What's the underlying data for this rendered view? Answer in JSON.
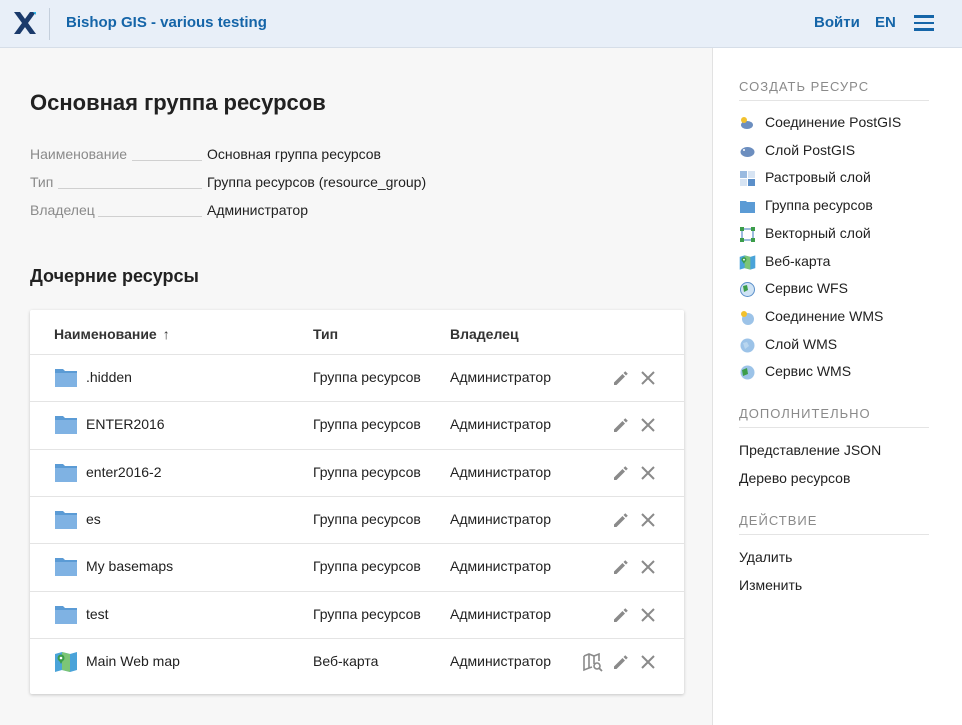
{
  "header": {
    "app_title": "Bishop GIS - various testing",
    "login_label": "Войти",
    "lang_label": "EN",
    "accent_color": "#1565a8"
  },
  "main": {
    "title": "Основная группа ресурсов",
    "meta": [
      {
        "key": "Наименование",
        "value": "Основная группа ресурсов"
      },
      {
        "key": "Тип",
        "value": "Группа ресурсов (resource_group)"
      },
      {
        "key": "Владелец",
        "value": "Администратор"
      }
    ],
    "children_title": "Дочерние ресурсы",
    "table": {
      "columns": [
        "Наименование",
        "Тип",
        "Владелец"
      ],
      "sort_arrow": "↑",
      "rows": [
        {
          "name": ".hidden",
          "type": "Группа ресурсов",
          "owner": "Администратор",
          "icon": "folder-icon"
        },
        {
          "name": "ENTER2016",
          "type": "Группа ресурсов",
          "owner": "Администратор",
          "icon": "folder-icon"
        },
        {
          "name": "enter2016-2",
          "type": "Группа ресурсов",
          "owner": "Администратор",
          "icon": "folder-icon"
        },
        {
          "name": "es",
          "type": "Группа ресурсов",
          "owner": "Администратор",
          "icon": "folder-icon"
        },
        {
          "name": "My basemaps",
          "type": "Группа ресурсов",
          "owner": "Администратор",
          "icon": "folder-icon"
        },
        {
          "name": "test",
          "type": "Группа ресурсов",
          "owner": "Администратор",
          "icon": "folder-icon"
        },
        {
          "name": "Main Web map",
          "type": "Веб-карта",
          "owner": "Администратор",
          "icon": "webmap-icon"
        }
      ]
    }
  },
  "sidebar": {
    "create_title": "СОЗДАТЬ РЕСУРС",
    "create_items": [
      {
        "label": "Соединение PostGIS",
        "icon": "postgis-connection-icon"
      },
      {
        "label": "Слой PostGIS",
        "icon": "postgis-layer-icon"
      },
      {
        "label": "Растровый слой",
        "icon": "raster-layer-icon"
      },
      {
        "label": "Группа ресурсов",
        "icon": "resource-group-icon"
      },
      {
        "label": "Векторный слой",
        "icon": "vector-layer-icon"
      },
      {
        "label": "Веб-карта",
        "icon": "webmap-icon"
      },
      {
        "label": "Сервис WFS",
        "icon": "wfs-service-icon"
      },
      {
        "label": "Соединение WMS",
        "icon": "wms-connection-icon"
      },
      {
        "label": "Слой WMS",
        "icon": "wms-layer-icon"
      },
      {
        "label": "Сервис WMS",
        "icon": "wms-service-icon"
      }
    ],
    "extra_title": "ДОПОЛНИТЕЛЬНО",
    "extra_items": [
      "Представление JSON",
      "Дерево ресурсов"
    ],
    "action_title": "ДЕЙСТВИЕ",
    "action_items": [
      "Удалить",
      "Изменить"
    ]
  }
}
